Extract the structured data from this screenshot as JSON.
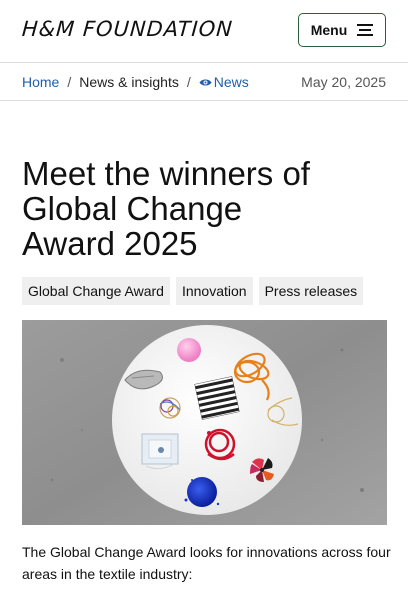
{
  "header": {
    "logo_text": "H&M FOUNDATION",
    "menu_label": "Menu"
  },
  "breadcrumb": {
    "items": [
      "Home",
      "News & insights",
      "News"
    ],
    "separator": "/",
    "date": "May 20, 2025"
  },
  "article": {
    "title": "Meet the winners of Global Change Award 2025",
    "tags": [
      "Global Change Award",
      "Innovation",
      "Press releases"
    ],
    "intro": "The Global Change Award looks for innovations across four areas in the textile industry:"
  },
  "colors": {
    "link": "#1f5fa8",
    "menu_border": "#2e5e3a",
    "tag_bg": "#efefef"
  },
  "icons": [
    "hamburger-icon",
    "eye-icon"
  ]
}
